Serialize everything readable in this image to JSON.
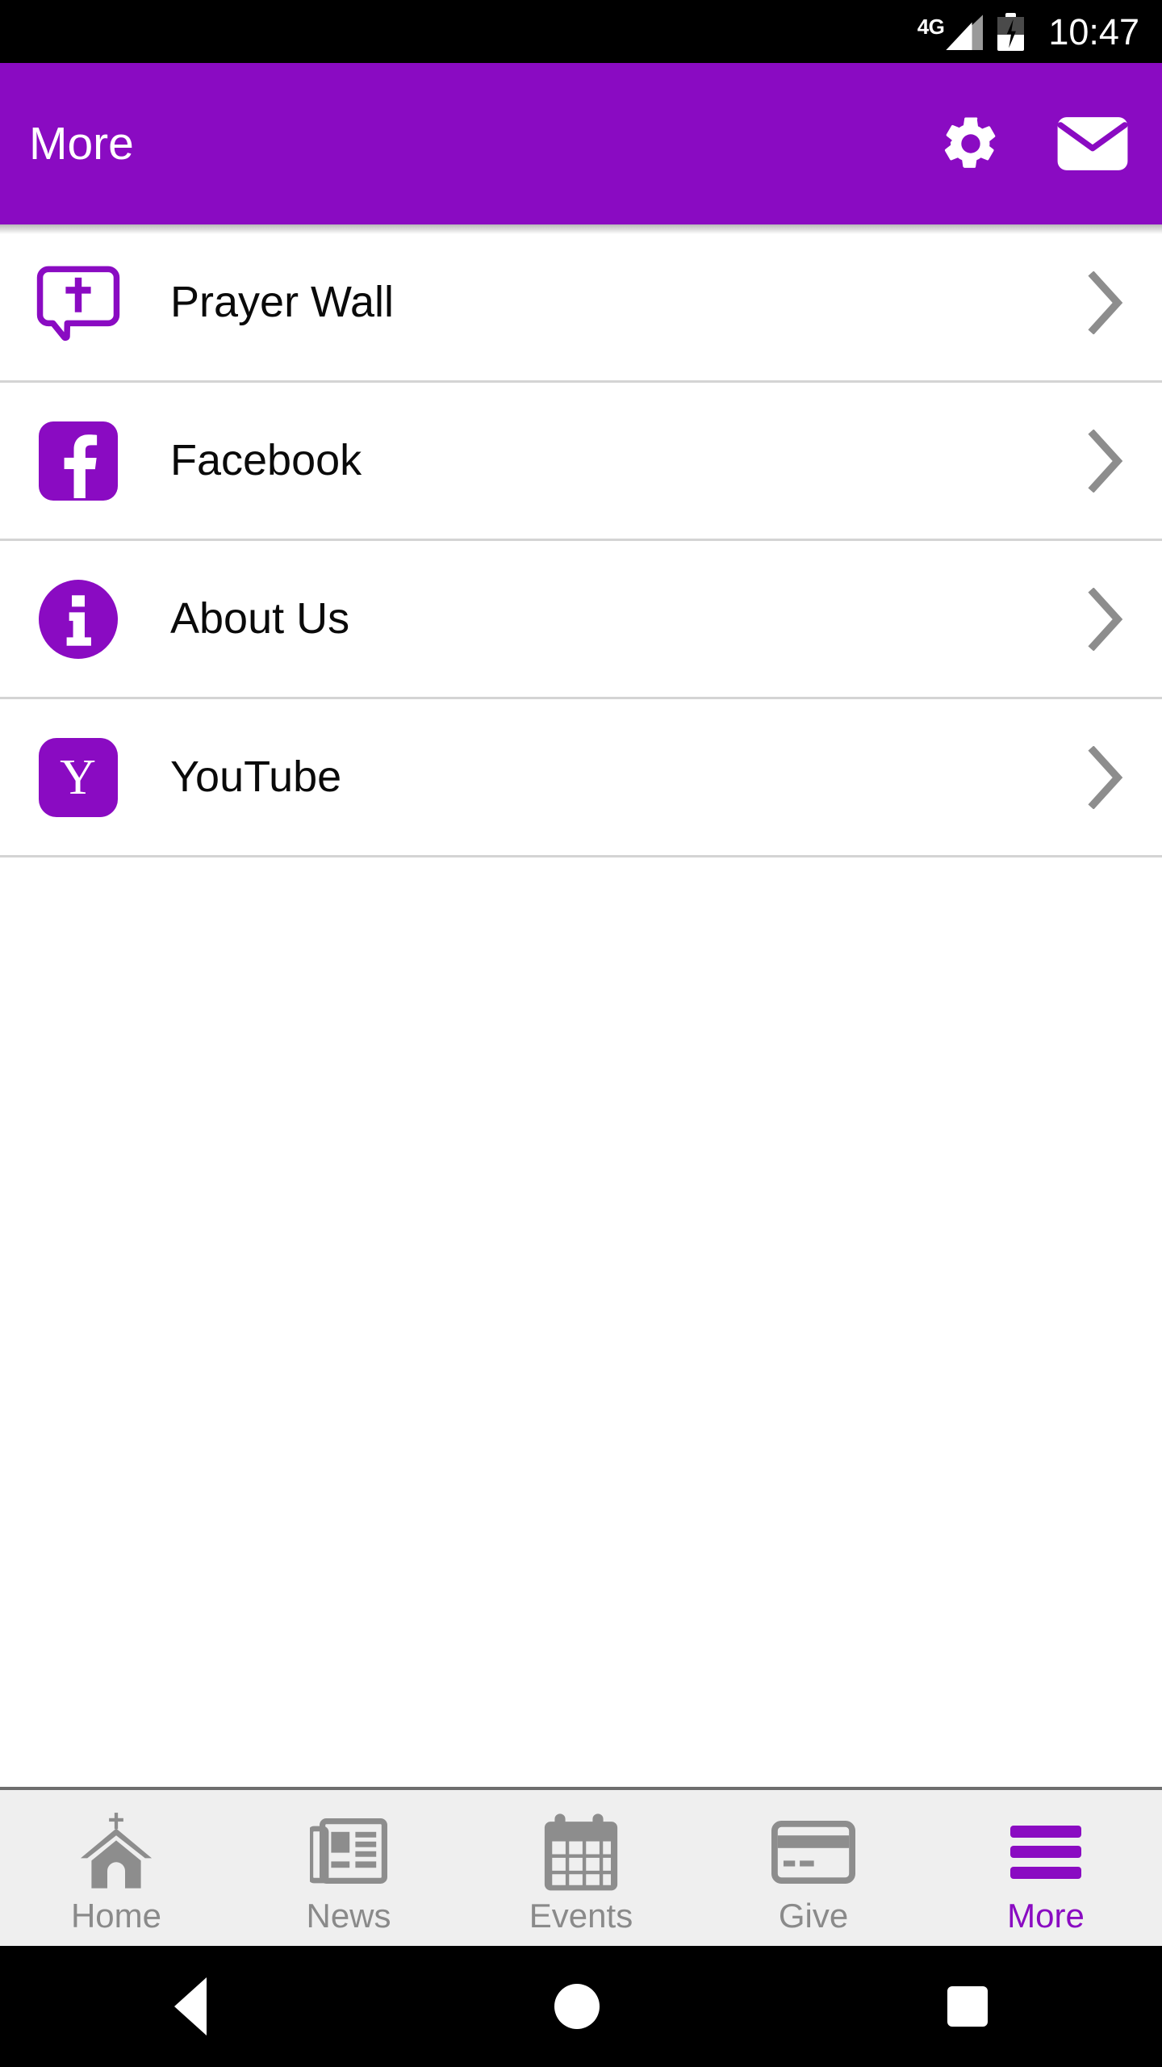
{
  "status_bar": {
    "network": "4G",
    "time": "10:47",
    "battery_icon": "battery-charging-icon",
    "signal_icon": "cellular-signal-icon"
  },
  "app_bar": {
    "title": "More",
    "actions": [
      {
        "name": "settings-button",
        "icon": "gear-icon"
      },
      {
        "name": "mail-button",
        "icon": "envelope-icon"
      }
    ]
  },
  "menu": {
    "items": [
      {
        "label": "Prayer Wall",
        "icon": "prayer-bubble-cross-icon",
        "chevron": "chevron-right-icon"
      },
      {
        "label": "Facebook",
        "icon": "facebook-icon",
        "chevron": "chevron-right-icon"
      },
      {
        "label": "About Us",
        "icon": "info-circle-icon",
        "chevron": "chevron-right-icon"
      },
      {
        "label": "YouTube",
        "icon": "youtube-icon",
        "chevron": "chevron-right-icon"
      }
    ]
  },
  "tab_bar": {
    "active": "More",
    "tabs": [
      {
        "label": "Home",
        "icon": "church-icon",
        "active": false
      },
      {
        "label": "News",
        "icon": "newspaper-icon",
        "active": false
      },
      {
        "label": "Events",
        "icon": "calendar-icon",
        "active": false
      },
      {
        "label": "Give",
        "icon": "credit-card-icon",
        "active": false
      },
      {
        "label": "More",
        "icon": "hamburger-icon",
        "active": true
      }
    ]
  },
  "nav_bar": {
    "back": "back-triangle-icon",
    "home": "home-circle-icon",
    "recents": "recents-square-icon"
  },
  "colors": {
    "brand_purple": "#8A0BC2",
    "status_bar_bg": "#000000",
    "tab_bar_bg": "#EFEFEF",
    "inactive_gray": "#8a8a8a",
    "divider": "#d4d4d4"
  }
}
